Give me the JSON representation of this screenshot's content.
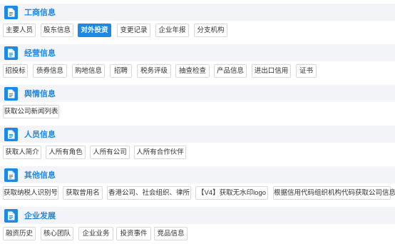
{
  "sections": [
    {
      "title": "工商信息",
      "chips": [
        {
          "label": "主要人员",
          "active": false
        },
        {
          "label": "股东信息",
          "active": false
        },
        {
          "label": "对外投资",
          "active": true
        },
        {
          "label": "变更记录",
          "active": false
        },
        {
          "label": "企业年报",
          "active": false
        },
        {
          "label": "分支机构",
          "active": false
        }
      ]
    },
    {
      "title": "经营信息",
      "chips": [
        {
          "label": "招投标",
          "active": false
        },
        {
          "label": "债券信息",
          "active": false
        },
        {
          "label": "购地信息",
          "active": false
        },
        {
          "label": "招聘",
          "active": false
        },
        {
          "label": "税务评级",
          "active": false
        },
        {
          "label": "抽查检查",
          "active": false
        },
        {
          "label": "产品信息",
          "active": false
        },
        {
          "label": "进出口信用",
          "active": false
        },
        {
          "label": "证书",
          "active": false
        }
      ]
    },
    {
      "title": "舆情信息",
      "chips": [
        {
          "label": "获取公司新闻列表",
          "active": false
        }
      ]
    },
    {
      "title": "人员信息",
      "chips": [
        {
          "label": "获取人简介",
          "active": false
        },
        {
          "label": "人所有角色",
          "active": false
        },
        {
          "label": "人所有公司",
          "active": false
        },
        {
          "label": "人所有合作伙伴",
          "active": false
        }
      ]
    },
    {
      "title": "其他信息",
      "chips": [
        {
          "label": "获取纳税人识别号",
          "active": false
        },
        {
          "label": "获取曾用名",
          "active": false
        },
        {
          "label": "香港公司、社会组织、律所",
          "active": false
        },
        {
          "label": "【V4】获取无水印logo",
          "active": false
        },
        {
          "label": "根据信用代码组织机构代码获取公司信息",
          "active": false
        }
      ]
    },
    {
      "title": "企业发展",
      "chips": [
        {
          "label": "融资历史",
          "active": false
        },
        {
          "label": "核心团队",
          "active": false
        },
        {
          "label": "企业业务",
          "active": false
        },
        {
          "label": "投资事件",
          "active": false
        },
        {
          "label": "竞品信息",
          "active": false
        }
      ]
    }
  ],
  "icon": "document-icon",
  "colors": {
    "accent": "#1e88e5",
    "header_bg": "#f2f4f7",
    "border": "#d9d9d9"
  }
}
